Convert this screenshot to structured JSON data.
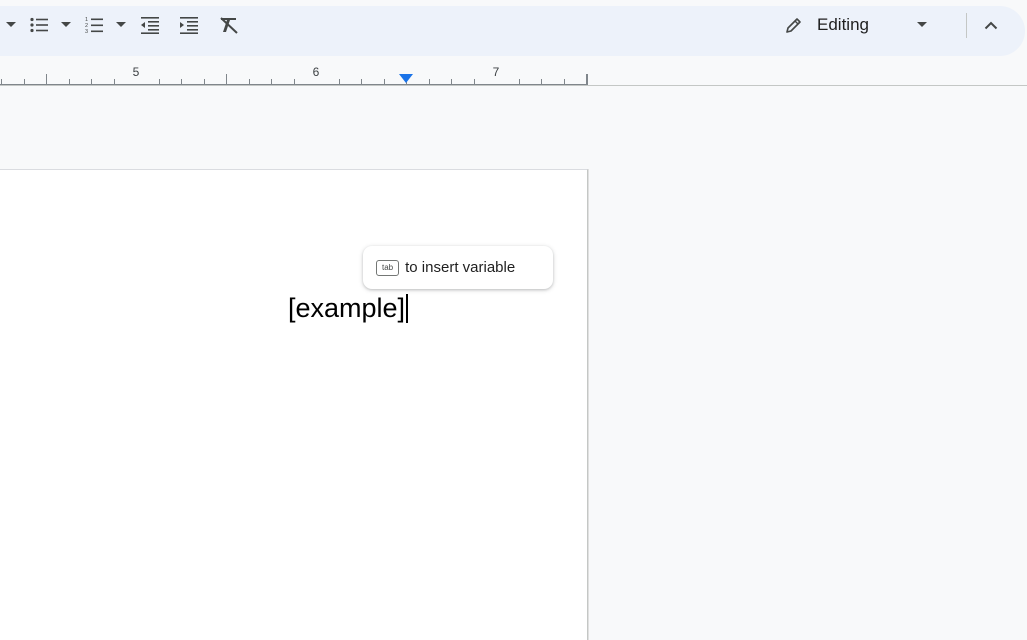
{
  "toolbar": {
    "buttons": [
      {
        "name": "more-dropdown",
        "icon": "caret-down-icon"
      },
      {
        "name": "bulleted-list",
        "icon": "bulleted-list-icon"
      },
      {
        "name": "bulleted-list-options",
        "icon": "caret-down-icon"
      },
      {
        "name": "numbered-list",
        "icon": "numbered-list-icon"
      },
      {
        "name": "numbered-list-options",
        "icon": "caret-down-icon"
      },
      {
        "name": "decrease-indent",
        "icon": "decrease-indent-icon"
      },
      {
        "name": "increase-indent",
        "icon": "increase-indent-icon"
      },
      {
        "name": "clear-formatting",
        "icon": "clear-formatting-icon"
      }
    ],
    "mode": {
      "label": "Editing",
      "icon": "pencil-icon"
    },
    "collapse_icon": "chevron-up-icon"
  },
  "ruler": {
    "labels": [
      "5",
      "6",
      "7"
    ]
  },
  "document": {
    "text": "[example]"
  },
  "tooltip": {
    "key": "tab",
    "text": "to insert variable"
  },
  "colors": {
    "accent": "#1a73e8",
    "toolbar_bg": "#edf2fa",
    "canvas_bg": "#f8f9fa"
  }
}
